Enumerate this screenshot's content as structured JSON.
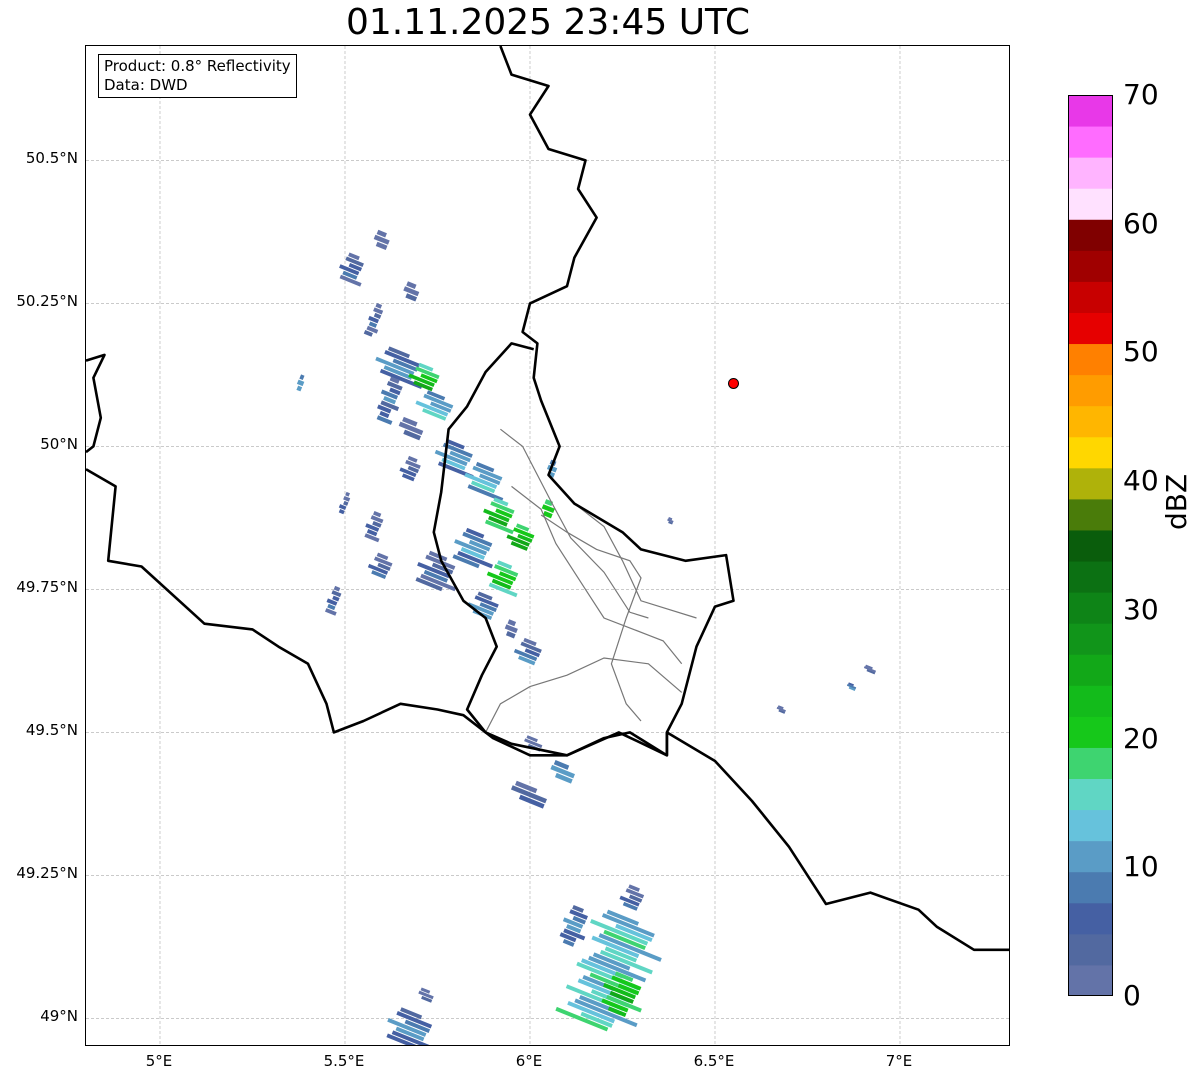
{
  "title": "01.11.2025 23:45 UTC",
  "info": {
    "product": "Product: 0.8° Reflectivity",
    "source": "Data: DWD"
  },
  "map": {
    "lon_range": [
      4.8,
      7.3
    ],
    "lat_range": [
      48.95,
      50.7
    ],
    "lon_ticks": [
      {
        "value": 5.0,
        "label": "5°E"
      },
      {
        "value": 5.5,
        "label": "5.5°E"
      },
      {
        "value": 6.0,
        "label": "6°E"
      },
      {
        "value": 6.5,
        "label": "6.5°E"
      },
      {
        "value": 7.0,
        "label": "7°E"
      }
    ],
    "lat_ticks": [
      {
        "value": 50.5,
        "label": "50.5°N"
      },
      {
        "value": 50.25,
        "label": "50.25°N"
      },
      {
        "value": 50.0,
        "label": "50°N"
      },
      {
        "value": 49.75,
        "label": "49.75°N"
      },
      {
        "value": 49.5,
        "label": "49.5°N"
      },
      {
        "value": 49.25,
        "label": "49.25°N"
      },
      {
        "value": 49.0,
        "label": "49°N"
      }
    ],
    "grid": true,
    "marker": {
      "lon": 6.55,
      "lat": 50.11,
      "color": "#ff0000"
    },
    "borders": [
      [
        [
          5.92,
          50.7
        ],
        [
          5.95,
          50.65
        ],
        [
          6.05,
          50.63
        ],
        [
          6.0,
          50.58
        ],
        [
          6.05,
          50.52
        ],
        [
          6.15,
          50.5
        ],
        [
          6.13,
          50.45
        ],
        [
          6.18,
          50.4
        ],
        [
          6.12,
          50.33
        ],
        [
          6.1,
          50.28
        ],
        [
          6.0,
          50.25
        ],
        [
          5.98,
          50.2
        ],
        [
          6.02,
          50.18
        ],
        [
          6.01,
          50.12
        ],
        [
          6.03,
          50.08
        ],
        [
          6.08,
          50.0
        ],
        [
          6.05,
          49.95
        ],
        [
          6.12,
          49.9
        ],
        [
          6.25,
          49.85
        ],
        [
          6.3,
          49.82
        ],
        [
          6.42,
          49.8
        ],
        [
          6.53,
          49.81
        ],
        [
          6.55,
          49.73
        ],
        [
          6.5,
          49.72
        ],
        [
          6.45,
          49.65
        ],
        [
          6.41,
          49.55
        ],
        [
          6.37,
          49.5
        ],
        [
          6.5,
          49.45
        ],
        [
          6.6,
          49.38
        ],
        [
          6.7,
          49.3
        ],
        [
          6.8,
          49.2
        ],
        [
          6.92,
          49.22
        ],
        [
          7.05,
          49.19
        ],
        [
          7.1,
          49.16
        ],
        [
          7.2,
          49.12
        ],
        [
          7.3,
          49.12
        ]
      ],
      [
        [
          4.8,
          50.15
        ],
        [
          4.85,
          50.16
        ],
        [
          4.82,
          50.12
        ],
        [
          4.84,
          50.05
        ],
        [
          4.82,
          50.0
        ],
        [
          4.8,
          49.99
        ]
      ],
      [
        [
          4.8,
          49.96
        ],
        [
          4.88,
          49.93
        ],
        [
          4.86,
          49.8
        ],
        [
          4.95,
          49.79
        ],
        [
          5.12,
          49.69
        ],
        [
          5.25,
          49.68
        ],
        [
          5.32,
          49.65
        ],
        [
          5.4,
          49.62
        ],
        [
          5.45,
          49.55
        ],
        [
          5.47,
          49.5
        ],
        [
          5.55,
          49.52
        ],
        [
          5.65,
          49.55
        ],
        [
          5.75,
          49.54
        ],
        [
          5.82,
          49.53
        ],
        [
          5.9,
          49.49
        ],
        [
          6.0,
          49.46
        ],
        [
          6.1,
          49.46
        ],
        [
          6.2,
          49.49
        ],
        [
          6.27,
          49.5
        ],
        [
          6.37,
          49.46
        ],
        [
          6.37,
          49.5
        ]
      ],
      [
        [
          6.01,
          50.17
        ],
        [
          5.95,
          50.18
        ],
        [
          5.88,
          50.13
        ],
        [
          5.83,
          50.07
        ],
        [
          5.78,
          50.03
        ],
        [
          5.76,
          49.92
        ],
        [
          5.74,
          49.85
        ],
        [
          5.76,
          49.8
        ],
        [
          5.82,
          49.73
        ],
        [
          5.88,
          49.7
        ],
        [
          5.91,
          49.65
        ],
        [
          5.87,
          49.6
        ],
        [
          5.83,
          49.54
        ],
        [
          5.88,
          49.5
        ],
        [
          5.95,
          49.48
        ],
        [
          6.1,
          49.46
        ],
        [
          6.24,
          49.5
        ],
        [
          6.37,
          49.46
        ],
        [
          6.37,
          49.5
        ]
      ]
    ],
    "admin_lines": [
      [
        [
          5.92,
          50.03
        ],
        [
          5.98,
          50.0
        ],
        [
          6.02,
          49.95
        ],
        [
          6.06,
          49.9
        ],
        [
          6.11,
          49.84
        ],
        [
          6.2,
          49.78
        ],
        [
          6.27,
          49.71
        ],
        [
          6.32,
          49.7
        ]
      ],
      [
        [
          6.03,
          49.88
        ],
        [
          6.1,
          49.85
        ],
        [
          6.18,
          49.82
        ],
        [
          6.27,
          49.8
        ],
        [
          6.3,
          49.77
        ],
        [
          6.26,
          49.7
        ],
        [
          6.22,
          49.62
        ],
        [
          6.26,
          49.55
        ],
        [
          6.3,
          49.52
        ]
      ],
      [
        [
          5.88,
          49.5
        ],
        [
          5.92,
          49.55
        ],
        [
          6.0,
          49.58
        ],
        [
          6.1,
          49.6
        ],
        [
          6.2,
          49.63
        ],
        [
          6.32,
          49.62
        ],
        [
          6.41,
          49.57
        ]
      ],
      [
        [
          6.05,
          49.95
        ],
        [
          6.12,
          49.9
        ],
        [
          6.2,
          49.86
        ],
        [
          6.25,
          49.8
        ],
        [
          6.3,
          49.73
        ],
        [
          6.45,
          49.7
        ]
      ],
      [
        [
          5.95,
          49.93
        ],
        [
          6.03,
          49.89
        ],
        [
          6.07,
          49.83
        ],
        [
          6.15,
          49.75
        ],
        [
          6.2,
          49.7
        ],
        [
          6.28,
          49.68
        ],
        [
          6.36,
          49.66
        ],
        [
          6.41,
          49.62
        ]
      ]
    ],
    "echoes": [
      {
        "lon": 5.52,
        "lat": 50.31,
        "w": 0.06,
        "h": 0.05,
        "dbz": 5
      },
      {
        "lon": 5.6,
        "lat": 50.36,
        "w": 0.05,
        "h": 0.03,
        "dbz": 2
      },
      {
        "lon": 5.68,
        "lat": 50.27,
        "w": 0.05,
        "h": 0.03,
        "dbz": 3
      },
      {
        "lon": 5.58,
        "lat": 50.22,
        "w": 0.03,
        "h": 0.06,
        "dbz": 4
      },
      {
        "lon": 5.65,
        "lat": 50.14,
        "w": 0.12,
        "h": 0.05,
        "dbz": 8
      },
      {
        "lon": 5.72,
        "lat": 50.12,
        "w": 0.08,
        "h": 0.04,
        "dbz": 21
      },
      {
        "lon": 5.62,
        "lat": 50.08,
        "w": 0.05,
        "h": 0.08,
        "dbz": 6
      },
      {
        "lon": 5.75,
        "lat": 50.07,
        "w": 0.1,
        "h": 0.04,
        "dbz": 12
      },
      {
        "lon": 5.68,
        "lat": 50.03,
        "w": 0.08,
        "h": 0.03,
        "dbz": 4
      },
      {
        "lon": 5.8,
        "lat": 49.98,
        "w": 0.1,
        "h": 0.05,
        "dbz": 10
      },
      {
        "lon": 5.68,
        "lat": 49.96,
        "w": 0.05,
        "h": 0.04,
        "dbz": 3
      },
      {
        "lon": 5.88,
        "lat": 49.94,
        "w": 0.1,
        "h": 0.05,
        "dbz": 12
      },
      {
        "lon": 5.92,
        "lat": 49.88,
        "w": 0.08,
        "h": 0.05,
        "dbz": 21
      },
      {
        "lon": 5.98,
        "lat": 49.84,
        "w": 0.07,
        "h": 0.04,
        "dbz": 23
      },
      {
        "lon": 5.85,
        "lat": 49.82,
        "w": 0.1,
        "h": 0.06,
        "dbz": 10
      },
      {
        "lon": 5.75,
        "lat": 49.78,
        "w": 0.1,
        "h": 0.06,
        "dbz": 4
      },
      {
        "lon": 5.93,
        "lat": 49.77,
        "w": 0.08,
        "h": 0.05,
        "dbz": 20
      },
      {
        "lon": 5.88,
        "lat": 49.72,
        "w": 0.08,
        "h": 0.04,
        "dbz": 8
      },
      {
        "lon": 5.58,
        "lat": 49.86,
        "w": 0.04,
        "h": 0.05,
        "dbz": 3
      },
      {
        "lon": 5.6,
        "lat": 49.79,
        "w": 0.06,
        "h": 0.04,
        "dbz": 4
      },
      {
        "lon": 5.47,
        "lat": 49.73,
        "w": 0.03,
        "h": 0.05,
        "dbz": 5
      },
      {
        "lon": 5.5,
        "lat": 49.9,
        "w": 0.02,
        "h": 0.04,
        "dbz": 3
      },
      {
        "lon": 6.0,
        "lat": 49.64,
        "w": 0.07,
        "h": 0.04,
        "dbz": 6
      },
      {
        "lon": 5.95,
        "lat": 49.68,
        "w": 0.04,
        "h": 0.03,
        "dbz": 3
      },
      {
        "lon": 6.05,
        "lat": 49.89,
        "w": 0.04,
        "h": 0.03,
        "dbz": 22
      },
      {
        "lon": 6.06,
        "lat": 49.96,
        "w": 0.03,
        "h": 0.03,
        "dbz": 12
      },
      {
        "lon": 6.01,
        "lat": 49.48,
        "w": 0.06,
        "h": 0.02,
        "dbz": 3
      },
      {
        "lon": 6.09,
        "lat": 49.43,
        "w": 0.08,
        "h": 0.03,
        "dbz": 12
      },
      {
        "lon": 6.0,
        "lat": 49.39,
        "w": 0.12,
        "h": 0.03,
        "dbz": 6
      },
      {
        "lon": 6.22,
        "lat": 49.08,
        "w": 0.18,
        "h": 0.2,
        "dbz": 14
      },
      {
        "lon": 6.25,
        "lat": 49.04,
        "w": 0.1,
        "h": 0.07,
        "dbz": 22
      },
      {
        "lon": 6.28,
        "lat": 49.21,
        "w": 0.06,
        "h": 0.04,
        "dbz": 4
      },
      {
        "lon": 6.12,
        "lat": 49.16,
        "w": 0.06,
        "h": 0.07,
        "dbz": 8
      },
      {
        "lon": 5.68,
        "lat": 48.98,
        "w": 0.12,
        "h": 0.06,
        "dbz": 8
      },
      {
        "lon": 5.72,
        "lat": 49.04,
        "w": 0.05,
        "h": 0.02,
        "dbz": 4
      },
      {
        "lon": 6.92,
        "lat": 49.61,
        "w": 0.04,
        "h": 0.01,
        "dbz": 4
      },
      {
        "lon": 6.87,
        "lat": 49.58,
        "w": 0.03,
        "h": 0.01,
        "dbz": 10
      },
      {
        "lon": 6.68,
        "lat": 49.54,
        "w": 0.03,
        "h": 0.01,
        "dbz": 4
      },
      {
        "lon": 6.38,
        "lat": 49.87,
        "w": 0.02,
        "h": 0.01,
        "dbz": 4
      },
      {
        "lon": 5.38,
        "lat": 50.11,
        "w": 0.02,
        "h": 0.03,
        "dbz": 12
      }
    ]
  },
  "colorbar": {
    "label": "dBZ",
    "min": 0,
    "max": 70,
    "step": 2.5,
    "ticks": [
      "0",
      "10",
      "20",
      "30",
      "40",
      "50",
      "60",
      "70"
    ],
    "colors": [
      "#6373a8",
      "#5269a0",
      "#4560a3",
      "#4b7bb0",
      "#5a9cc6",
      "#66c2dc",
      "#60d6c4",
      "#3ed470",
      "#16c81a",
      "#13bb1b",
      "#12a818",
      "#11951a",
      "#0e8417",
      "#0c7113",
      "#0a5d0c",
      "#4a7c0a",
      "#afb20a",
      "#ffd700",
      "#ffb600",
      "#ff9c00",
      "#ff8000",
      "#e60000",
      "#c80000",
      "#a00000",
      "#800000",
      "#ffe1ff",
      "#ffb4ff",
      "#ff6cff",
      "#e838e8"
    ]
  }
}
